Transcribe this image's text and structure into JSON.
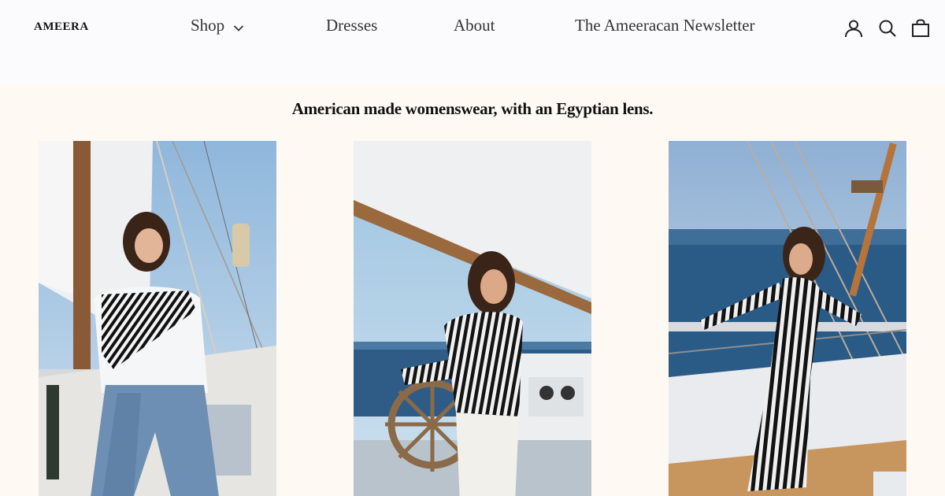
{
  "header": {
    "logo": "AMEERA",
    "nav": {
      "shop": "Shop",
      "dresses": "Dresses",
      "about": "About",
      "newsletter": "The Ameeracan Newsletter"
    },
    "icons": [
      "account-icon",
      "search-icon",
      "cart-icon"
    ]
  },
  "hero": {
    "tagline": "American made womenswear, with an Egyptian lens.",
    "photos": [
      {
        "subject": "model in white shirt with striped sweater and wide-leg jeans on sailboat deck"
      },
      {
        "subject": "model in black and white striped shirt at ship's helm"
      },
      {
        "subject": "model in black and white striped maxi dress at ship's railing"
      }
    ]
  },
  "colors": {
    "header_bg": "#fbfbfd",
    "hero_bg": "#fef9f3",
    "text": "#1a1a1a",
    "nav_text": "#333333"
  }
}
